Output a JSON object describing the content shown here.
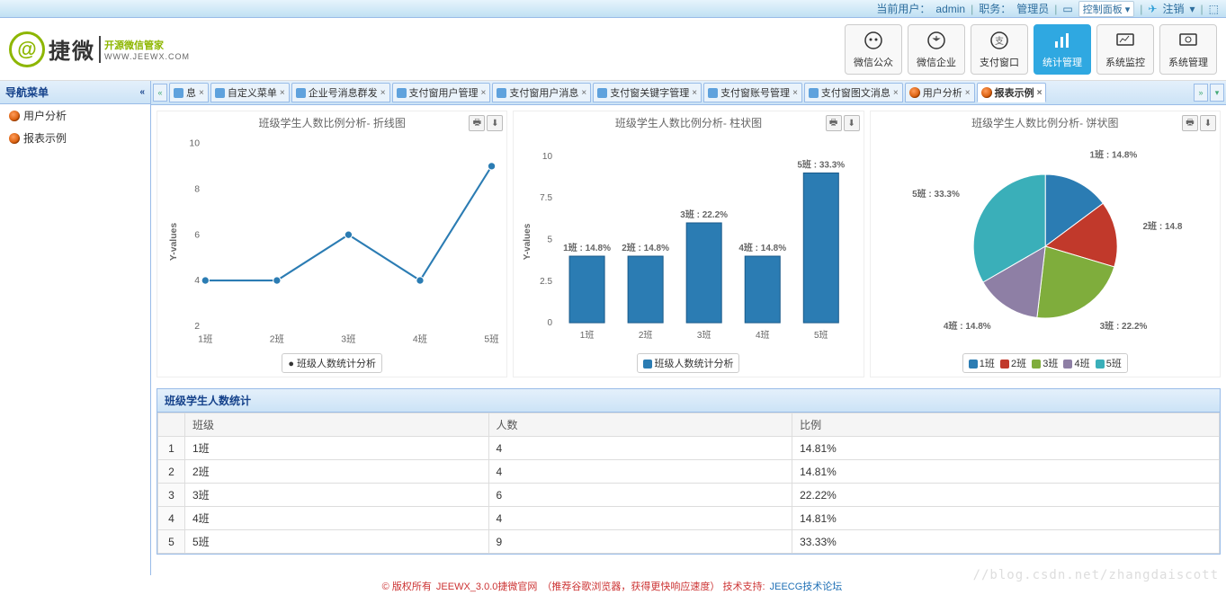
{
  "topbar": {
    "current_user_label": "当前用户：",
    "current_user": "admin",
    "role_label": "职务：",
    "role": "管理员",
    "control_panel": "控制面板",
    "logout": "注销"
  },
  "logo": {
    "main": "捷微",
    "sub": "开源微信管家",
    "url": "WWW.JEEWX.COM"
  },
  "modules": [
    {
      "label": "微信公众"
    },
    {
      "label": "微信企业"
    },
    {
      "label": "支付窗口"
    },
    {
      "label": "统计管理"
    },
    {
      "label": "系统监控"
    },
    {
      "label": "系统管理"
    }
  ],
  "active_module_index": 3,
  "sidebar": {
    "title": "导航菜单",
    "items": [
      "用户分析",
      "报表示例"
    ]
  },
  "tabs": [
    {
      "label": "息"
    },
    {
      "label": "自定义菜单"
    },
    {
      "label": "企业号消息群发"
    },
    {
      "label": "支付窗用户管理"
    },
    {
      "label": "支付窗用户消息"
    },
    {
      "label": "支付窗关键字管理"
    },
    {
      "label": "支付窗账号管理"
    },
    {
      "label": "支付窗图文消息"
    },
    {
      "label": "用户分析"
    },
    {
      "label": "报表示例"
    }
  ],
  "active_tab_index": 9,
  "charts_common": {
    "ylabel": "Y-values",
    "legend_label": "班级人数统计分析"
  },
  "chart_line": {
    "title": "班级学生人数比例分析- 折线图"
  },
  "chart_bar": {
    "title": "班级学生人数比例分析- 柱状图"
  },
  "chart_pie": {
    "title": "班级学生人数比例分析- 饼状图",
    "legend": [
      "1班",
      "2班",
      "3班",
      "4班",
      "5班"
    ]
  },
  "table": {
    "title": "班级学生人数统计",
    "headers": [
      "班级",
      "人数",
      "比例"
    ],
    "rows": [
      {
        "class": "1班",
        "count": "4",
        "ratio": "14.81%"
      },
      {
        "class": "2班",
        "count": "4",
        "ratio": "14.81%"
      },
      {
        "class": "3班",
        "count": "6",
        "ratio": "22.22%"
      },
      {
        "class": "4班",
        "count": "4",
        "ratio": "14.81%"
      },
      {
        "class": "5班",
        "count": "9",
        "ratio": "33.33%"
      }
    ]
  },
  "footer": {
    "copyright_prefix": "© 版权所有 ",
    "site": "JEEWX_3.0.0捷微官网",
    "browser_tip": "（推荐谷歌浏览器，获得更快响应速度）",
    "tech_label": " 技术支持: ",
    "tech_link": "JEECG技术论坛"
  },
  "watermark": "//blog.csdn.net/zhangdaiscott",
  "chart_data": [
    {
      "type": "line",
      "title": "班级学生人数比例分析- 折线图",
      "categories": [
        "1班",
        "2班",
        "3班",
        "4班",
        "5班"
      ],
      "values": [
        4,
        4,
        6,
        4,
        9
      ],
      "ylabel": "Y-values",
      "ylim": [
        2,
        10
      ],
      "series_name": "班级人数统计分析"
    },
    {
      "type": "bar",
      "title": "班级学生人数比例分析- 柱状图",
      "categories": [
        "1班",
        "2班",
        "3班",
        "4班",
        "5班"
      ],
      "values": [
        4,
        4,
        6,
        4,
        9
      ],
      "labels": [
        "1班 : 14.8%",
        "2班 : 14.8%",
        "3班 : 22.2%",
        "4班 : 14.8%",
        "5班 : 33.3%"
      ],
      "ylabel": "Y-values",
      "ylim": [
        0,
        10
      ],
      "series_name": "班级人数统计分析"
    },
    {
      "type": "pie",
      "title": "班级学生人数比例分析- 饼状图",
      "series": [
        {
          "name": "1班",
          "value": 14.8,
          "label": "1班 : 14.8%",
          "color": "#2b7cb3"
        },
        {
          "name": "2班",
          "value": 14.8,
          "label": "2班 : 14.8",
          "color": "#c1392b"
        },
        {
          "name": "3班",
          "value": 22.2,
          "label": "3班 : 22.2%",
          "color": "#7fad3c"
        },
        {
          "name": "4班",
          "value": 14.8,
          "label": "4班 : 14.8%",
          "color": "#8e7fa5"
        },
        {
          "name": "5班",
          "value": 33.3,
          "label": "5班 : 33.3%",
          "color": "#3aafb9"
        }
      ]
    }
  ]
}
